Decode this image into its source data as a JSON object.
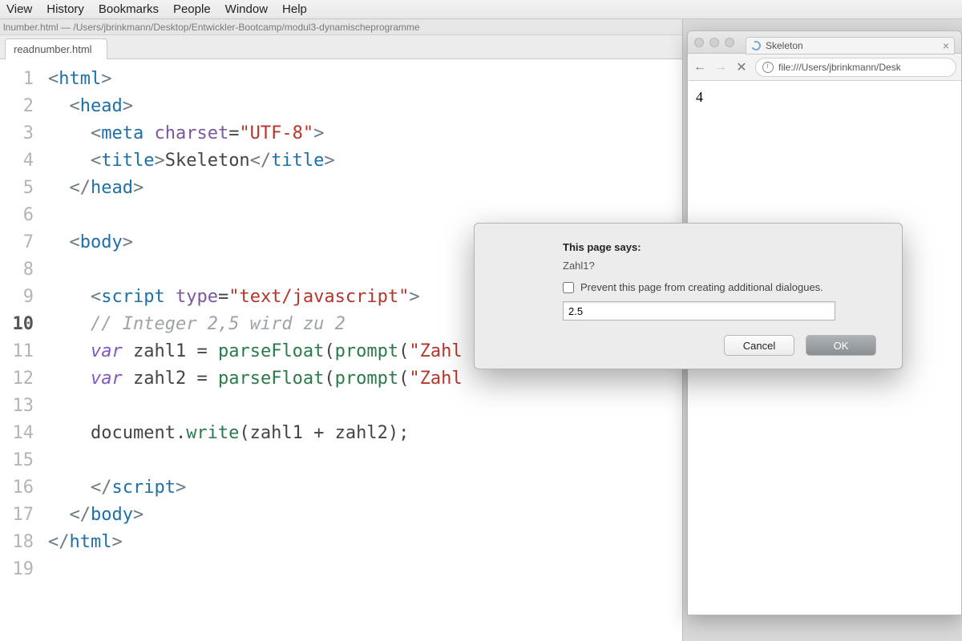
{
  "menubar": [
    "View",
    "History",
    "Bookmarks",
    "People",
    "Window",
    "Help"
  ],
  "editor": {
    "title_path": "lnumber.html — /Users/jbrinkmann/Desktop/Entwickler-Bootcamp/modul3-dynamischeprogramme",
    "tab_label": "readnumber.html",
    "current_line": 10,
    "lines": [
      {
        "n": 1,
        "html": "<span class='t-angle'>&lt;</span><span class='t-tag'>html</span><span class='t-angle'>&gt;</span>"
      },
      {
        "n": 2,
        "html": "  <span class='t-angle'>&lt;</span><span class='t-tag'>head</span><span class='t-angle'>&gt;</span>"
      },
      {
        "n": 3,
        "html": "    <span class='t-angle'>&lt;</span><span class='t-tag'>meta</span> <span class='t-attr'>charset</span>=<span class='t-str'>\"UTF-8\"</span><span class='t-angle'>&gt;</span>"
      },
      {
        "n": 4,
        "html": "    <span class='t-angle'>&lt;</span><span class='t-tag'>title</span><span class='t-angle'>&gt;</span>Skeleton<span class='t-angle'>&lt;/</span><span class='t-tag'>title</span><span class='t-angle'>&gt;</span>"
      },
      {
        "n": 5,
        "html": "  <span class='t-angle'>&lt;/</span><span class='t-tag'>head</span><span class='t-angle'>&gt;</span>"
      },
      {
        "n": 6,
        "html": ""
      },
      {
        "n": 7,
        "html": "  <span class='t-angle'>&lt;</span><span class='t-tag'>body</span><span class='t-angle'>&gt;</span>"
      },
      {
        "n": 8,
        "html": ""
      },
      {
        "n": 9,
        "html": "    <span class='t-angle'>&lt;</span><span class='t-tag'>script</span> <span class='t-attr'>type</span>=<span class='t-str'>\"text/javascript\"</span><span class='t-angle'>&gt;</span>"
      },
      {
        "n": 10,
        "html": "    <span class='t-cm'>// Integer 2,5 wird zu 2</span>"
      },
      {
        "n": 11,
        "html": "    <span class='t-kw'>var</span> <span class='t-id'>zahl1</span> = <span class='t-fn'>parseFloat</span>(<span class='t-fn'>prompt</span>(<span class='t-str'>\"Zahl</span>"
      },
      {
        "n": 12,
        "html": "    <span class='t-kw'>var</span> <span class='t-id'>zahl2</span> = <span class='t-fn'>parseFloat</span>(<span class='t-fn'>prompt</span>(<span class='t-str'>\"Zahl</span>"
      },
      {
        "n": 13,
        "html": ""
      },
      {
        "n": 14,
        "html": "    document.<span class='t-fn'>write</span>(zahl1 + zahl2);"
      },
      {
        "n": 15,
        "html": ""
      },
      {
        "n": 16,
        "html": "    <span class='t-angle'>&lt;/</span><span class='t-tag'>script</span><span class='t-angle'>&gt;</span>"
      },
      {
        "n": 17,
        "html": "  <span class='t-angle'>&lt;/</span><span class='t-tag'>body</span><span class='t-angle'>&gt;</span>"
      },
      {
        "n": 18,
        "html": "<span class='t-angle'>&lt;/</span><span class='t-tag'>html</span><span class='t-angle'>&gt;</span>"
      },
      {
        "n": 19,
        "html": ""
      }
    ]
  },
  "browser": {
    "tab_title": "Skeleton",
    "address": "file:///Users/jbrinkmann/Desk",
    "page_output": "4",
    "nav": {
      "back": "←",
      "forward": "→",
      "stop": "✕"
    }
  },
  "dialog": {
    "title": "This page says:",
    "message": "Zahl1?",
    "suppress_label": "Prevent this page from creating additional dialogues.",
    "input_value": "2.5",
    "cancel_label": "Cancel",
    "ok_label": "OK"
  }
}
